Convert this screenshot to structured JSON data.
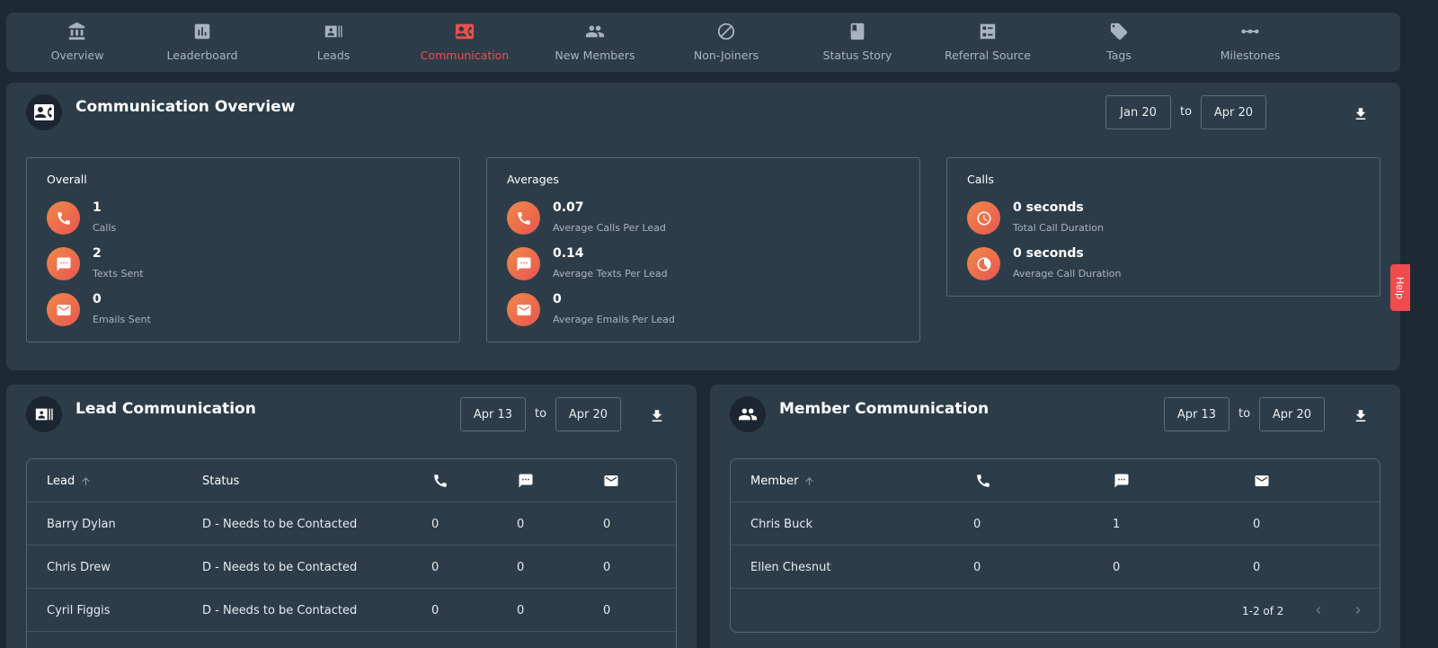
{
  "nav": {
    "items": [
      {
        "label": "Overview",
        "icon": "bank-icon"
      },
      {
        "label": "Leaderboard",
        "icon": "leaderboard-icon"
      },
      {
        "label": "Leads",
        "icon": "contacts-icon"
      },
      {
        "label": "Communication",
        "icon": "contact-card-icon"
      },
      {
        "label": "New Members",
        "icon": "people-icon"
      },
      {
        "label": "Non-Joiners",
        "icon": "block-icon"
      },
      {
        "label": "Status Story",
        "icon": "book-icon"
      },
      {
        "label": "Referral Source",
        "icon": "fact-check-icon"
      },
      {
        "label": "Tags",
        "icon": "tag-icon"
      },
      {
        "label": "Milestones",
        "icon": "timeline-icon"
      }
    ],
    "active_color": "#ef4d4d"
  },
  "overview": {
    "title": "Communication Overview",
    "date_from": "Jan 20",
    "to_label": "to",
    "date_to": "Apr 20",
    "cards": {
      "overall": {
        "title": "Overall",
        "rows": [
          {
            "value": "1",
            "label": "Calls",
            "icon": "phone-icon"
          },
          {
            "value": "2",
            "label": "Texts Sent",
            "icon": "sms-icon"
          },
          {
            "value": "0",
            "label": "Emails Sent",
            "icon": "email-icon"
          }
        ]
      },
      "averages": {
        "title": "Averages",
        "rows": [
          {
            "value": "0.07",
            "label": "Average Calls Per Lead",
            "icon": "phone-icon"
          },
          {
            "value": "0.14",
            "label": "Average Texts Per Lead",
            "icon": "sms-icon"
          },
          {
            "value": "0",
            "label": "Average Emails Per Lead",
            "icon": "email-icon"
          }
        ]
      },
      "calls": {
        "title": "Calls",
        "rows": [
          {
            "value": "0 seconds",
            "label": "Total Call Duration",
            "icon": "clock-icon"
          },
          {
            "value": "0 seconds",
            "label": "Average Call Duration",
            "icon": "pie-icon"
          }
        ]
      }
    }
  },
  "lead_comm": {
    "title": "Lead Communication",
    "date_from": "Apr 13",
    "to_label": "to",
    "date_to": "Apr 20",
    "headers": {
      "lead": "Lead",
      "status": "Status"
    },
    "rows": [
      {
        "name": "Barry Dylan",
        "status": "D - Needs to be Contacted",
        "calls": "0",
        "texts": "0",
        "emails": "0"
      },
      {
        "name": "Chris Drew",
        "status": "D - Needs to be Contacted",
        "calls": "0",
        "texts": "0",
        "emails": "0"
      },
      {
        "name": "Cyril Figgis",
        "status": "D - Needs to be Contacted",
        "calls": "0",
        "texts": "0",
        "emails": "0"
      }
    ]
  },
  "member_comm": {
    "title": "Member Communication",
    "date_from": "Apr 13",
    "to_label": "to",
    "date_to": "Apr 20",
    "headers": {
      "member": "Member"
    },
    "rows": [
      {
        "name": "Chris Buck",
        "calls": "0",
        "texts": "1",
        "emails": "0"
      },
      {
        "name": "Ellen Chesnut",
        "calls": "0",
        "texts": "0",
        "emails": "0"
      }
    ],
    "pagination": "1-2 of 2"
  },
  "help_tab": "Help",
  "colors": {
    "background": "#1d2a33",
    "panel": "#2c3d49",
    "accent": "#ef4d4d",
    "stat_gradient_start": "#f08a4b",
    "stat_gradient_end": "#e8554e"
  }
}
